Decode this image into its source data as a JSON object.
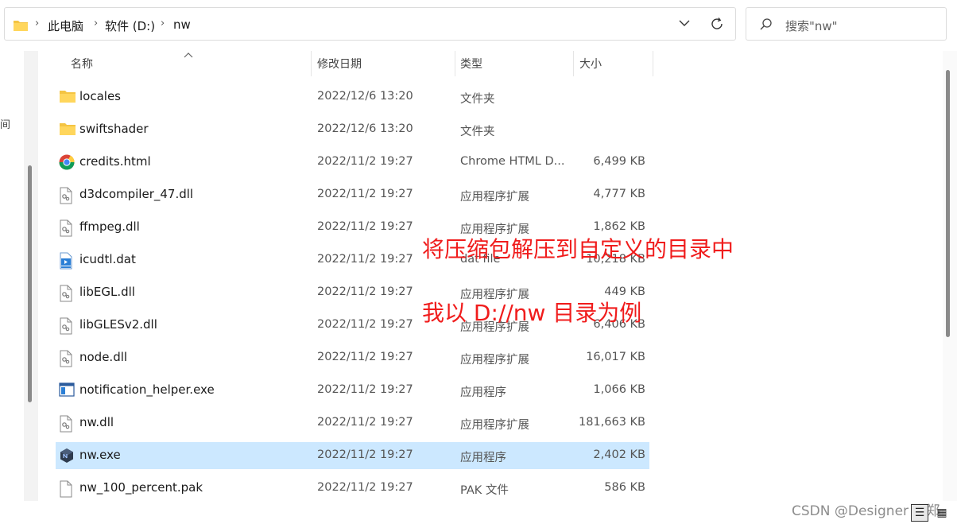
{
  "addressbar": {
    "crumbs": [
      "此电脑",
      "软件 (D:)",
      "nw"
    ]
  },
  "search": {
    "placeholder": "搜索\"nw\""
  },
  "sidebar": {
    "partial_text": "间"
  },
  "columns": {
    "name": "名称",
    "date": "修改日期",
    "type": "类型",
    "size": "大小"
  },
  "files": [
    {
      "name": "locales",
      "date": "2022/12/6 13:20",
      "type": "文件夹",
      "size": "",
      "icon": "folder-icon"
    },
    {
      "name": "swiftshader",
      "date": "2022/12/6 13:20",
      "type": "文件夹",
      "size": "",
      "icon": "folder-icon"
    },
    {
      "name": "credits.html",
      "date": "2022/11/2 19:27",
      "type": "Chrome HTML D...",
      "size": "6,499 KB",
      "icon": "chrome-icon"
    },
    {
      "name": "d3dcompiler_47.dll",
      "date": "2022/11/2 19:27",
      "type": "应用程序扩展",
      "size": "4,777 KB",
      "icon": "dll-file-icon"
    },
    {
      "name": "ffmpeg.dll",
      "date": "2022/11/2 19:27",
      "type": "应用程序扩展",
      "size": "1,862 KB",
      "icon": "dll-file-icon"
    },
    {
      "name": "icudtl.dat",
      "date": "2022/11/2 19:27",
      "type": "dat file",
      "size": "10,218 KB",
      "icon": "dat-file-icon"
    },
    {
      "name": "libEGL.dll",
      "date": "2022/11/2 19:27",
      "type": "应用程序扩展",
      "size": "449 KB",
      "icon": "dll-file-icon"
    },
    {
      "name": "libGLESv2.dll",
      "date": "2022/11/2 19:27",
      "type": "应用程序扩展",
      "size": "6,406 KB",
      "icon": "dll-file-icon"
    },
    {
      "name": "node.dll",
      "date": "2022/11/2 19:27",
      "type": "应用程序扩展",
      "size": "16,017 KB",
      "icon": "dll-file-icon"
    },
    {
      "name": "notification_helper.exe",
      "date": "2022/11/2 19:27",
      "type": "应用程序",
      "size": "1,066 KB",
      "icon": "exe-window-icon"
    },
    {
      "name": "nw.dll",
      "date": "2022/11/2 19:27",
      "type": "应用程序扩展",
      "size": "181,663 KB",
      "icon": "dll-file-icon"
    },
    {
      "name": "nw.exe",
      "date": "2022/11/2 19:27",
      "type": "应用程序",
      "size": "2,402 KB",
      "icon": "nwjs-app-icon",
      "selected": true
    },
    {
      "name": "nw_100_percent.pak",
      "date": "2022/11/2 19:27",
      "type": "PAK 文件",
      "size": "586 KB",
      "icon": "blank-file-icon"
    }
  ],
  "annotations": {
    "line1": "将压缩包解压到自定义的目录中",
    "line2": "我以 D://nw 目录为例",
    "color": "#f01c1c"
  },
  "watermark": "CSDN @Designer 小郑",
  "corner": {
    "left_glyph": "☰",
    "right_glyph": "▦"
  }
}
